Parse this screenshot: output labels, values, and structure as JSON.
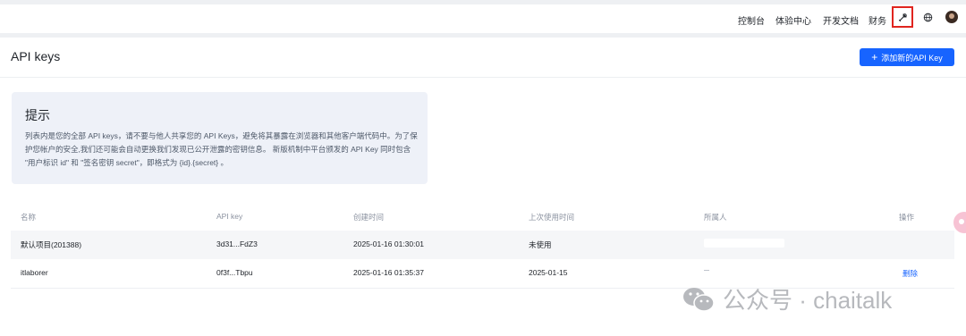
{
  "nav": {
    "links": [
      "控制台",
      "体验中心",
      "开发文档",
      "财务"
    ]
  },
  "page": {
    "title": "API keys",
    "add_button": "添加新的API Key"
  },
  "tip": {
    "title": "提示",
    "body": "列表内是您的全部 API keys，请不要与他人共享您的 API Keys，避免将其暴露在浏览器和其他客户端代码中。为了保护您帐户的安全,我们还可能会自动更换我们发现已公开泄露的密钥信息。 新版机制中平台颁发的 API Key 同时包含 \"用户标识 id\" 和 \"签名密钥 secret\"，即格式为 {id}.{secret} 。"
  },
  "table": {
    "headers": [
      "名称",
      "API key",
      "创建时间",
      "上次使用时间",
      "所属人",
      "操作"
    ],
    "rows": [
      {
        "name": "默认项目(201388)",
        "key": "3d31...FdZ3",
        "created": "2025-01-16 01:30:01",
        "last_used": "未使用",
        "owner": "",
        "action": ""
      },
      {
        "name": "itlaborer",
        "key": "0f3f...Tbpu",
        "created": "2025-01-16 01:35:37",
        "last_used": "2025-01-15",
        "owner": "",
        "action": "删除"
      }
    ]
  },
  "watermark": {
    "text": "公众号 · chaitalk"
  },
  "colors": {
    "primary": "#1764ff",
    "highlight_box": "#e0251f",
    "tip_bg": "#eef1f8"
  },
  "icons": [
    "tools-icon",
    "globe-icon",
    "avatar",
    "plus-icon",
    "wechat-icon"
  ]
}
